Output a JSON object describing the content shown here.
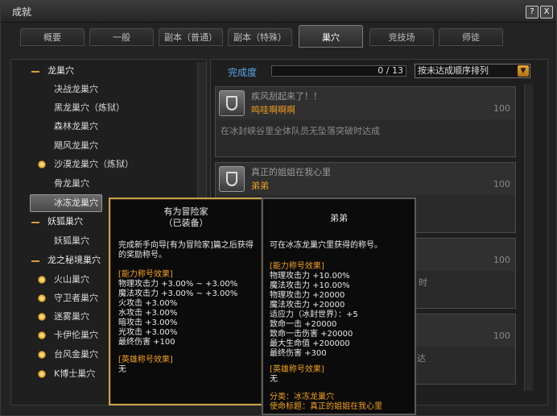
{
  "window": {
    "title": "成就"
  },
  "title_buttons": {
    "help": "?",
    "close": "X"
  },
  "tabs": [
    "概要",
    "一般",
    "副本（普通）",
    "副本（特殊）",
    "巢穴",
    "竞技场",
    "师徒"
  ],
  "left_list": {
    "items": [
      {
        "label": "龙巢穴",
        "type": "category"
      },
      {
        "label": "决战龙巢穴",
        "type": "item"
      },
      {
        "label": "黑龙巢穴（炼狱）",
        "type": "item"
      },
      {
        "label": "森林龙巢穴",
        "type": "item"
      },
      {
        "label": "飓风龙巢穴",
        "type": "item"
      },
      {
        "label": "沙漠龙巢穴（炼狱）",
        "type": "item"
      },
      {
        "label": "骨龙巢穴",
        "type": "item"
      },
      {
        "label": "冰冻龙巢穴",
        "type": "item"
      },
      {
        "label": "妖狐巢穴",
        "type": "category"
      },
      {
        "label": "妖狐巢穴",
        "type": "item"
      },
      {
        "label": "龙之秘境巢穴",
        "type": "category"
      },
      {
        "label": "火山巢穴",
        "type": "item"
      },
      {
        "label": "守卫者巢穴",
        "type": "item"
      },
      {
        "label": "迷雾巢穴",
        "type": "item"
      },
      {
        "label": "卡伊伦巢穴",
        "type": "item"
      },
      {
        "label": "台风金巢穴",
        "type": "item"
      },
      {
        "label": "K博士巢穴",
        "type": "item"
      }
    ]
  },
  "progress": {
    "label": "完成度",
    "value": "0 / 13",
    "fraction": 0
  },
  "sort": {
    "selected": "按未达成顺序排列"
  },
  "cards": [
    {
      "title": "疾风刮起来了！！",
      "reward": "鸣哇啊啊啊",
      "score": "100",
      "desc": "在冰封峡谷里全体队员无坠落突破时达成"
    },
    {
      "title": "真正的姐姐在我心里",
      "reward": "弟弟",
      "score": "100",
      "desc": ""
    },
    {
      "title": "",
      "reward": "",
      "score": "100",
      "desc": "时"
    },
    {
      "title": "",
      "reward": "",
      "score": "100",
      "desc": "达"
    }
  ],
  "tooltip_left": {
    "title": "有为冒险家",
    "subtitle": "（已装备）",
    "desc1": "完成新手向导[有为冒险家]篇之后获得",
    "desc2": "的奖励称号。",
    "effects_header": "[能力称号效果]",
    "effects": [
      "物理攻击力 +3.00% ~ +3.00%",
      "魔法攻击力 +3.00% ~ +3.00%",
      "火攻击 +3.00%",
      "水攻击 +3.00%",
      "暗攻击 +3.00%",
      "光攻击 +3.00%",
      "最终伤害 +100"
    ],
    "hero_header": "[英雄称号效果]",
    "hero_value": "无"
  },
  "tooltip_right": {
    "title": "弟弟",
    "desc": "可在冰冻龙巢穴里获得的称号。",
    "effects_header": "[能力称号效果]",
    "effects": [
      "物理攻击力 +10.00%",
      "魔法攻击力 +10.00%",
      "物理攻击力 +20000",
      "魔法攻击力 +20000",
      "适应力（冰封世界）：+5",
      "致命一击 +20000",
      "致命一击伤害 +20000",
      "最大生命值 +200000",
      "最终伤害 +300"
    ],
    "hero_header": "[英雄称号效果]",
    "hero_value": "无",
    "category": "分类：冰冻龙巢穴",
    "mission": "使命标题：真正的姐姐在我心里"
  }
}
